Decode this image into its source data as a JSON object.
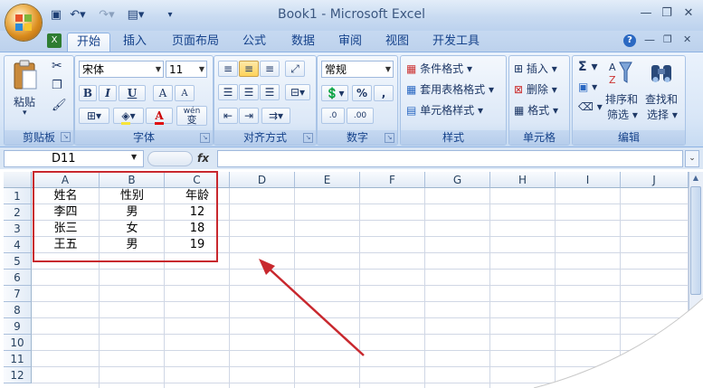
{
  "window": {
    "title": "Book1 - Microsoft Excel"
  },
  "tabs": [
    {
      "label": "开始"
    },
    {
      "label": "插入"
    },
    {
      "label": "页面布局"
    },
    {
      "label": "公式"
    },
    {
      "label": "数据"
    },
    {
      "label": "审阅"
    },
    {
      "label": "视图"
    },
    {
      "label": "开发工具"
    }
  ],
  "ribbon": {
    "clipboard": {
      "group_label": "剪贴板",
      "paste_label": "粘贴"
    },
    "font": {
      "group_label": "字体",
      "font_name": "宋体",
      "font_size": "11",
      "bold": "B",
      "italic": "I",
      "underline": "U",
      "grow": "A",
      "shrink": "A",
      "font_color": "A",
      "phonetic": "wén",
      "phonetic_char": "变"
    },
    "alignment": {
      "group_label": "对齐方式"
    },
    "number": {
      "group_label": "数字",
      "format": "常规",
      "percent": "%",
      "comma": ",",
      "inc_decimal": ".0",
      "dec_decimal": ".00"
    },
    "styles": {
      "group_label": "样式",
      "conditional": "条件格式",
      "table_format": "套用表格格式",
      "cell_styles": "单元格样式"
    },
    "cells": {
      "group_label": "单元格",
      "insert": "插入",
      "delete": "删除",
      "format": "格式"
    },
    "editing": {
      "group_label": "编辑",
      "sum": "Σ",
      "sort_filter_1": "排序和",
      "sort_filter_2": "筛选",
      "find_select_1": "查找和",
      "find_select_2": "选择"
    }
  },
  "formula_bar": {
    "name_box": "D11",
    "fx": "fx",
    "formula": ""
  },
  "sheet": {
    "columns": [
      "A",
      "B",
      "C",
      "D",
      "E",
      "F",
      "G",
      "H",
      "I",
      "J"
    ],
    "rows": [
      "1",
      "2",
      "3",
      "4",
      "5",
      "6",
      "7",
      "8",
      "9",
      "10",
      "11",
      "12"
    ],
    "data": [
      [
        "姓名",
        "性别",
        "年龄"
      ],
      [
        "李四",
        "男",
        "12"
      ],
      [
        "张三",
        "女",
        "18"
      ],
      [
        "王五",
        "男",
        "19"
      ]
    ]
  },
  "colors": {
    "highlight": "#c8282e",
    "arrow": "#c8282e",
    "ribbon_text": "#15428b"
  }
}
